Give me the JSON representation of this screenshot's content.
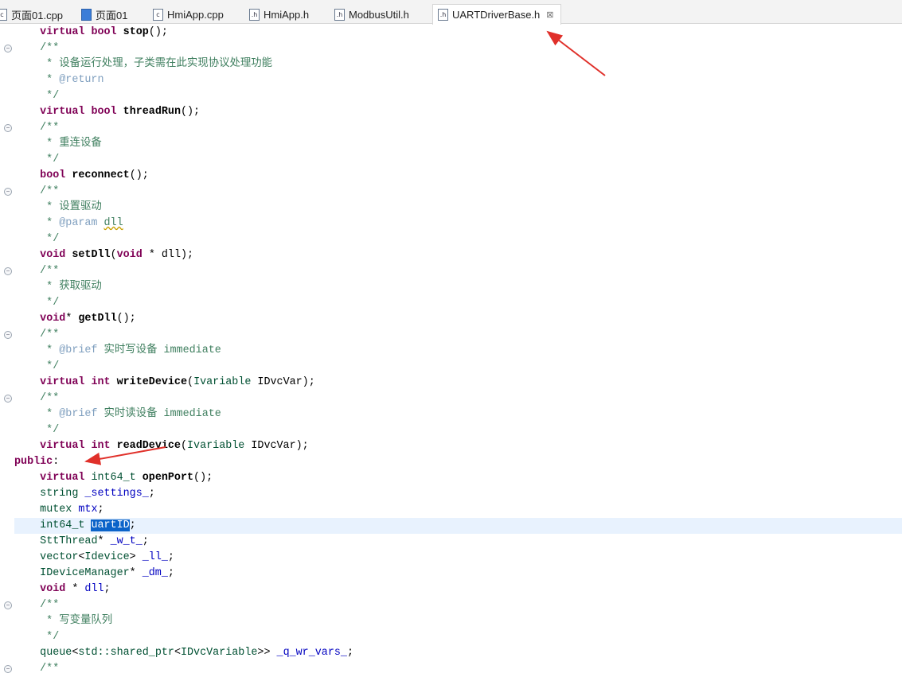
{
  "tabs": [
    {
      "label": "页面01.cpp",
      "icon": "cpp-file-icon",
      "active": false
    },
    {
      "label": "页面01",
      "icon": "form-icon",
      "active": false
    },
    {
      "label": "HmiApp.cpp",
      "icon": "c-source-file-icon",
      "active": false
    },
    {
      "label": "HmiApp.h",
      "icon": "header-file-icon",
      "active": false
    },
    {
      "label": "ModbusUtil.h",
      "icon": "header-file-icon",
      "active": false
    },
    {
      "label": "UARTDriverBase.h",
      "icon": "header-file-icon",
      "active": true
    }
  ],
  "colors": {
    "keyword": "#7f0055",
    "type": "#005032",
    "field": "#0000c0",
    "comment": "#3f7f5f",
    "selection": "#0b63c9",
    "annotation_arrow": "#e0302a"
  },
  "editor": {
    "current_line": 31,
    "lines": [
      {
        "fold": false,
        "tokens": [
          [
            "p",
            "    "
          ],
          [
            "k",
            "virtual"
          ],
          [
            "p",
            " "
          ],
          [
            "k",
            "bool"
          ],
          [
            "p",
            " "
          ],
          [
            "m",
            "stop"
          ],
          [
            "p",
            "();"
          ]
        ]
      },
      {
        "fold": true,
        "tokens": [
          [
            "c",
            "    /**"
          ]
        ]
      },
      {
        "fold": false,
        "tokens": [
          [
            "c",
            "     * 设备运行处理，子类需在此实现协议处理功能"
          ]
        ]
      },
      {
        "fold": false,
        "tokens": [
          [
            "c",
            "     * "
          ],
          [
            "j",
            "@return"
          ]
        ]
      },
      {
        "fold": false,
        "tokens": [
          [
            "c",
            "     */"
          ]
        ]
      },
      {
        "fold": false,
        "tokens": [
          [
            "p",
            "    "
          ],
          [
            "k",
            "virtual"
          ],
          [
            "p",
            " "
          ],
          [
            "k",
            "bool"
          ],
          [
            "p",
            " "
          ],
          [
            "m",
            "threadRun"
          ],
          [
            "p",
            "();"
          ]
        ]
      },
      {
        "fold": true,
        "tokens": [
          [
            "c",
            "    /**"
          ]
        ]
      },
      {
        "fold": false,
        "tokens": [
          [
            "c",
            "     * 重连设备"
          ]
        ]
      },
      {
        "fold": false,
        "tokens": [
          [
            "c",
            "     */"
          ]
        ]
      },
      {
        "fold": false,
        "tokens": [
          [
            "p",
            "    "
          ],
          [
            "k",
            "bool"
          ],
          [
            "p",
            " "
          ],
          [
            "m",
            "reconnect"
          ],
          [
            "p",
            "();"
          ]
        ]
      },
      {
        "fold": true,
        "tokens": [
          [
            "c",
            "    /**"
          ]
        ]
      },
      {
        "fold": false,
        "tokens": [
          [
            "c",
            "     * 设置驱动"
          ]
        ]
      },
      {
        "fold": false,
        "tokens": [
          [
            "c",
            "     * "
          ],
          [
            "j",
            "@param"
          ],
          [
            "c",
            " "
          ],
          [
            "u",
            "dll"
          ]
        ]
      },
      {
        "fold": false,
        "tokens": [
          [
            "c",
            "     */"
          ]
        ]
      },
      {
        "fold": false,
        "tokens": [
          [
            "p",
            "    "
          ],
          [
            "k",
            "void"
          ],
          [
            "p",
            " "
          ],
          [
            "m",
            "setDll"
          ],
          [
            "p",
            "("
          ],
          [
            "k",
            "void"
          ],
          [
            "p",
            " * dll);"
          ]
        ]
      },
      {
        "fold": true,
        "tokens": [
          [
            "c",
            "    /**"
          ]
        ]
      },
      {
        "fold": false,
        "tokens": [
          [
            "c",
            "     * 获取驱动"
          ]
        ]
      },
      {
        "fold": false,
        "tokens": [
          [
            "c",
            "     */"
          ]
        ]
      },
      {
        "fold": false,
        "tokens": [
          [
            "p",
            "    "
          ],
          [
            "k",
            "void"
          ],
          [
            "p",
            "* "
          ],
          [
            "m",
            "getDll"
          ],
          [
            "p",
            "();"
          ]
        ]
      },
      {
        "fold": true,
        "tokens": [
          [
            "c",
            "    /**"
          ]
        ]
      },
      {
        "fold": false,
        "tokens": [
          [
            "c",
            "     * "
          ],
          [
            "j",
            "@brief"
          ],
          [
            "c",
            " 实时写设备 immediate"
          ]
        ]
      },
      {
        "fold": false,
        "tokens": [
          [
            "c",
            "     */"
          ]
        ]
      },
      {
        "fold": false,
        "tokens": [
          [
            "p",
            "    "
          ],
          [
            "k",
            "virtual"
          ],
          [
            "p",
            " "
          ],
          [
            "k",
            "int"
          ],
          [
            "p",
            " "
          ],
          [
            "m",
            "writeDevice"
          ],
          [
            "p",
            "("
          ],
          [
            "t",
            "Ivariable"
          ],
          [
            "p",
            " IDvcVar);"
          ]
        ]
      },
      {
        "fold": true,
        "tokens": [
          [
            "c",
            "    /**"
          ]
        ]
      },
      {
        "fold": false,
        "tokens": [
          [
            "c",
            "     * "
          ],
          [
            "j",
            "@brief"
          ],
          [
            "c",
            " 实时读设备 immediate"
          ]
        ]
      },
      {
        "fold": false,
        "tokens": [
          [
            "c",
            "     */"
          ]
        ]
      },
      {
        "fold": false,
        "tokens": [
          [
            "p",
            "    "
          ],
          [
            "k",
            "virtual"
          ],
          [
            "p",
            " "
          ],
          [
            "k",
            "int"
          ],
          [
            "p",
            " "
          ],
          [
            "m",
            "readDevice"
          ],
          [
            "p",
            "("
          ],
          [
            "t",
            "Ivariable"
          ],
          [
            "p",
            " IDvcVar);"
          ]
        ]
      },
      {
        "fold": false,
        "tokens": [
          [
            "k",
            "public"
          ],
          [
            "p",
            ":"
          ]
        ]
      },
      {
        "fold": false,
        "tokens": [
          [
            "p",
            "    "
          ],
          [
            "k",
            "virtual"
          ],
          [
            "p",
            " "
          ],
          [
            "t",
            "int64_t"
          ],
          [
            "p",
            " "
          ],
          [
            "m",
            "openPort"
          ],
          [
            "p",
            "();"
          ]
        ]
      },
      {
        "fold": false,
        "tokens": [
          [
            "p",
            "    "
          ],
          [
            "t",
            "string"
          ],
          [
            "p",
            " "
          ],
          [
            "f",
            "_settings_"
          ],
          [
            "p",
            ";"
          ]
        ]
      },
      {
        "fold": false,
        "tokens": [
          [
            "p",
            "    "
          ],
          [
            "t",
            "mutex"
          ],
          [
            "p",
            " "
          ],
          [
            "f",
            "mtx"
          ],
          [
            "p",
            ";"
          ]
        ]
      },
      {
        "fold": false,
        "tokens": [
          [
            "p",
            "    "
          ],
          [
            "t",
            "int64_t"
          ],
          [
            "p",
            " "
          ],
          [
            "s",
            "uartID"
          ],
          [
            "p",
            ";"
          ]
        ]
      },
      {
        "fold": false,
        "tokens": [
          [
            "p",
            "    "
          ],
          [
            "t",
            "SttThread"
          ],
          [
            "p",
            "* "
          ],
          [
            "f",
            "_w_t_"
          ],
          [
            "p",
            ";"
          ]
        ]
      },
      {
        "fold": false,
        "tokens": [
          [
            "p",
            "    "
          ],
          [
            "t",
            "vector"
          ],
          [
            "p",
            "<"
          ],
          [
            "t",
            "Idevice"
          ],
          [
            "p",
            "> "
          ],
          [
            "f",
            "_ll_"
          ],
          [
            "p",
            ";"
          ]
        ]
      },
      {
        "fold": false,
        "tokens": [
          [
            "p",
            "    "
          ],
          [
            "t",
            "IDeviceManager"
          ],
          [
            "p",
            "* "
          ],
          [
            "f",
            "_dm_"
          ],
          [
            "p",
            ";"
          ]
        ]
      },
      {
        "fold": false,
        "tokens": [
          [
            "p",
            "    "
          ],
          [
            "k",
            "void"
          ],
          [
            "p",
            " * "
          ],
          [
            "f",
            "dll"
          ],
          [
            "p",
            ";"
          ]
        ]
      },
      {
        "fold": true,
        "tokens": [
          [
            "c",
            "    /**"
          ]
        ]
      },
      {
        "fold": false,
        "tokens": [
          [
            "c",
            "     * 写变量队列"
          ]
        ]
      },
      {
        "fold": false,
        "tokens": [
          [
            "c",
            "     */"
          ]
        ]
      },
      {
        "fold": false,
        "tokens": [
          [
            "p",
            "    "
          ],
          [
            "t",
            "queue"
          ],
          [
            "p",
            "<"
          ],
          [
            "t",
            "std::shared_ptr"
          ],
          [
            "p",
            "<"
          ],
          [
            "t",
            "IDvcVariable"
          ],
          [
            "p",
            ">> "
          ],
          [
            "f",
            "_q_wr_vars_"
          ],
          [
            "p",
            ";"
          ]
        ]
      },
      {
        "fold": true,
        "tokens": [
          [
            "c",
            "    /**"
          ]
        ]
      }
    ]
  }
}
